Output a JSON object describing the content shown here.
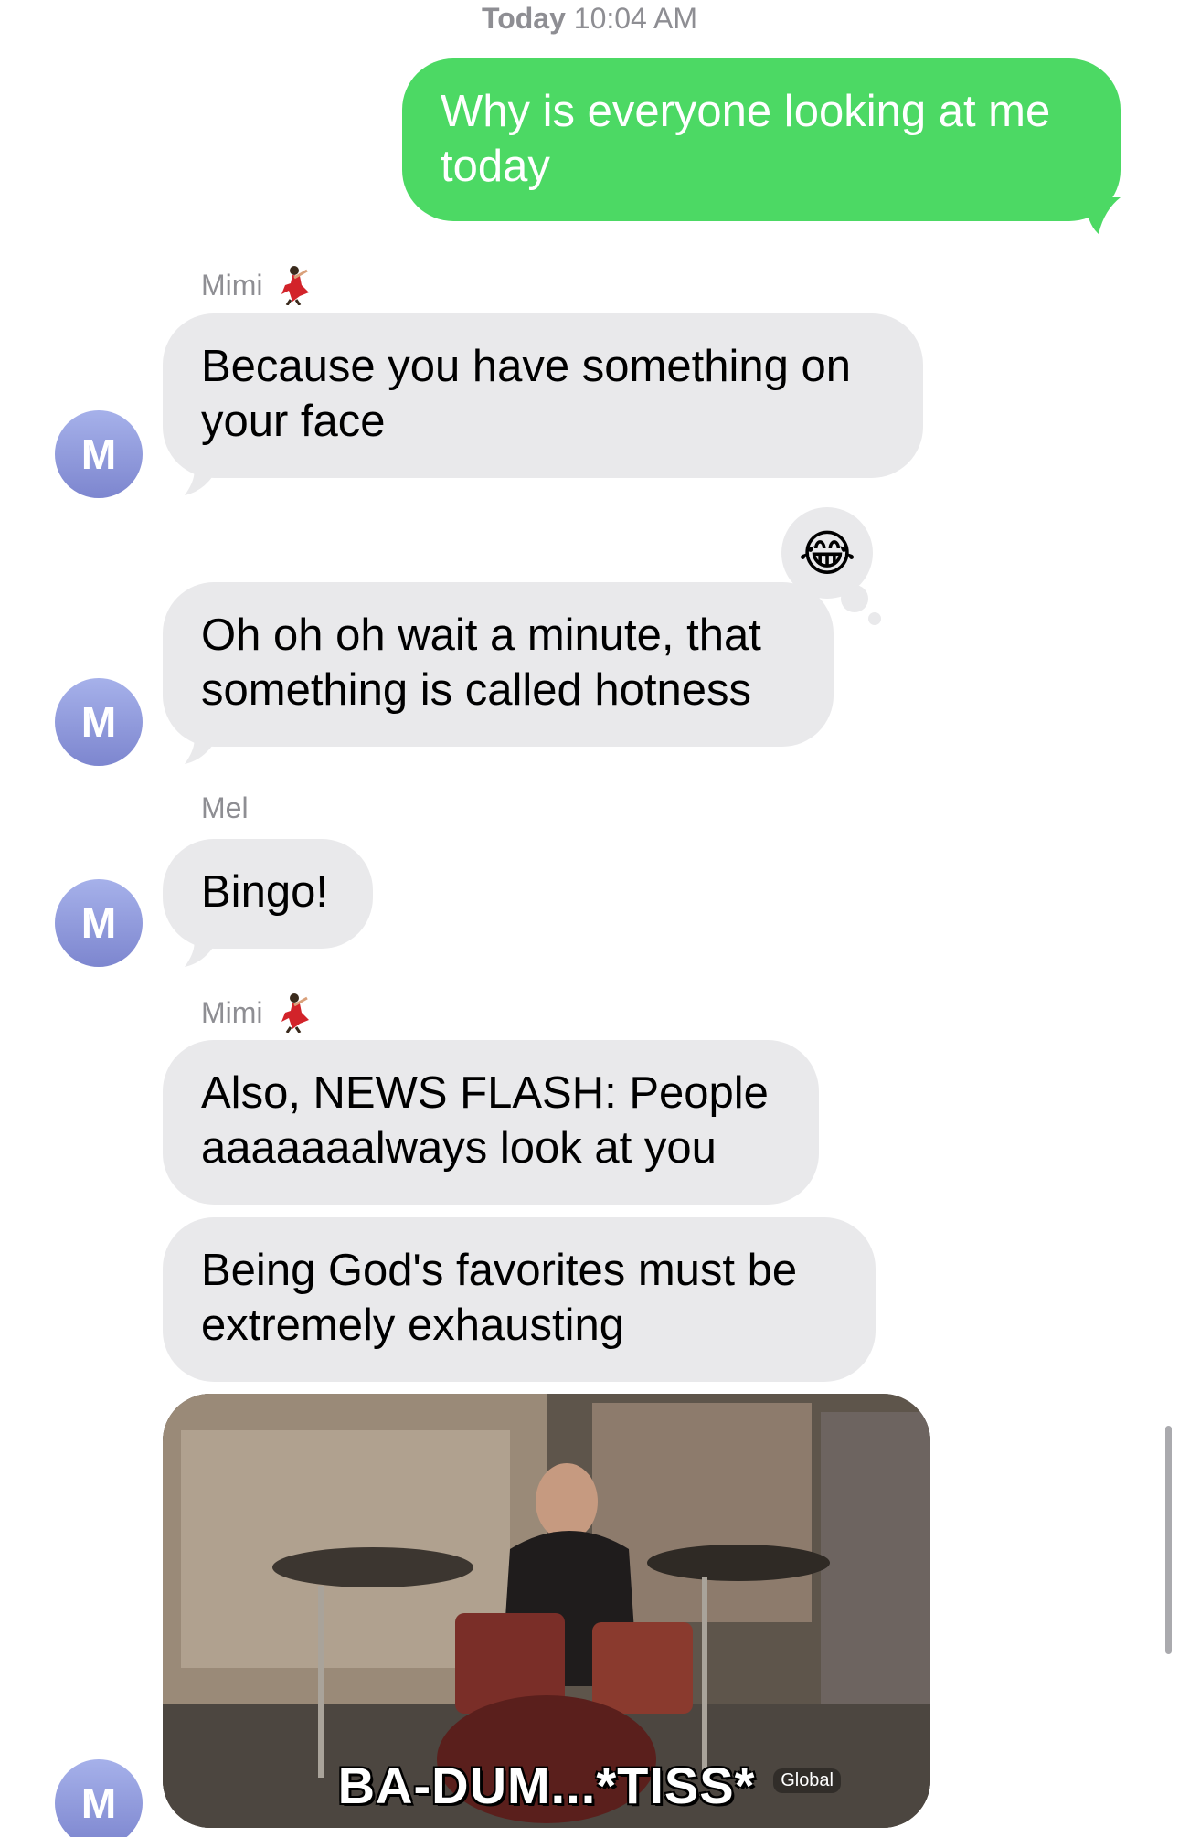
{
  "header": {
    "day": "Today",
    "time": "10:04 AM"
  },
  "messages": [
    {
      "text": "Why is everyone looking at me today"
    },
    {
      "text": "Because you have something on your face"
    },
    {
      "text": "Oh oh oh wait a minute, that something is called hotness"
    },
    {
      "text": "Bingo!"
    },
    {
      "text": "Also, NEWS FLASH: People aaaaaaalways look at you"
    },
    {
      "text": "Being God's favorites must be extremely exhausting"
    }
  ],
  "senders": {
    "mimi": "Mimi",
    "mel": "Mel"
  },
  "avatar_initial": "M",
  "reaction_emoji": "😂",
  "gif": {
    "caption": "BA-DUM...*TISS*",
    "logo": "Global"
  },
  "colors": {
    "outgoing": "#4cd964",
    "incoming": "#e9e9eb",
    "avatar": "#8f98dc"
  },
  "icons": {
    "sender_emoji": "dancer-icon"
  }
}
